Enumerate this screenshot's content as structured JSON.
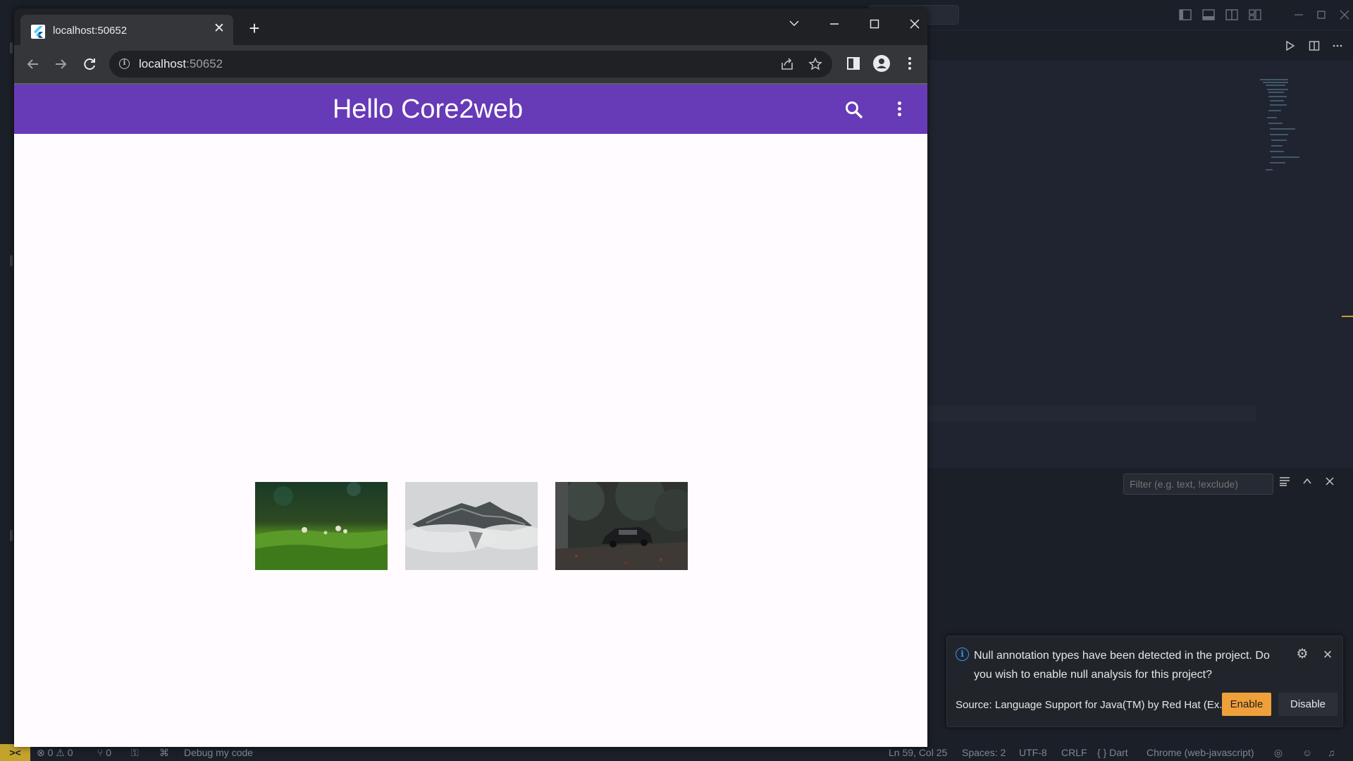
{
  "browser": {
    "tab_title": "localhost:50652",
    "url_host": "localhost",
    "url_port": ":50652",
    "new_tab_symbol": "+",
    "close_symbol": "✕"
  },
  "app": {
    "title": "Hello Core2web",
    "bar_color": "#673ab7",
    "images": [
      {
        "name": "moss-mushrooms-photo"
      },
      {
        "name": "misty-mountain-photo"
      },
      {
        "name": "car-in-forest-photo"
      }
    ]
  },
  "vscode": {
    "filter_placeholder": "Filter (e.g. text, !exclude)",
    "notification": {
      "message": "Null annotation types have been detected in the project. Do you wish to enable null analysis for this project?",
      "source": "Source: Language Support for Java(TM) by Red Hat (Ex...",
      "enable_label": "Enable",
      "disable_label": "Disable",
      "accent": "#f0a03a"
    },
    "status": {
      "remote": "><",
      "errors": "⊗ 0 ⚠ 0",
      "ports": "⑂ 0",
      "debug": "Debug my code",
      "position": "Ln 59, Col 25",
      "spaces": "Spaces: 2",
      "encoding": "UTF-8",
      "eol": "CRLF",
      "language": "{ } Dart",
      "device": "Chrome (web-javascript)"
    }
  }
}
